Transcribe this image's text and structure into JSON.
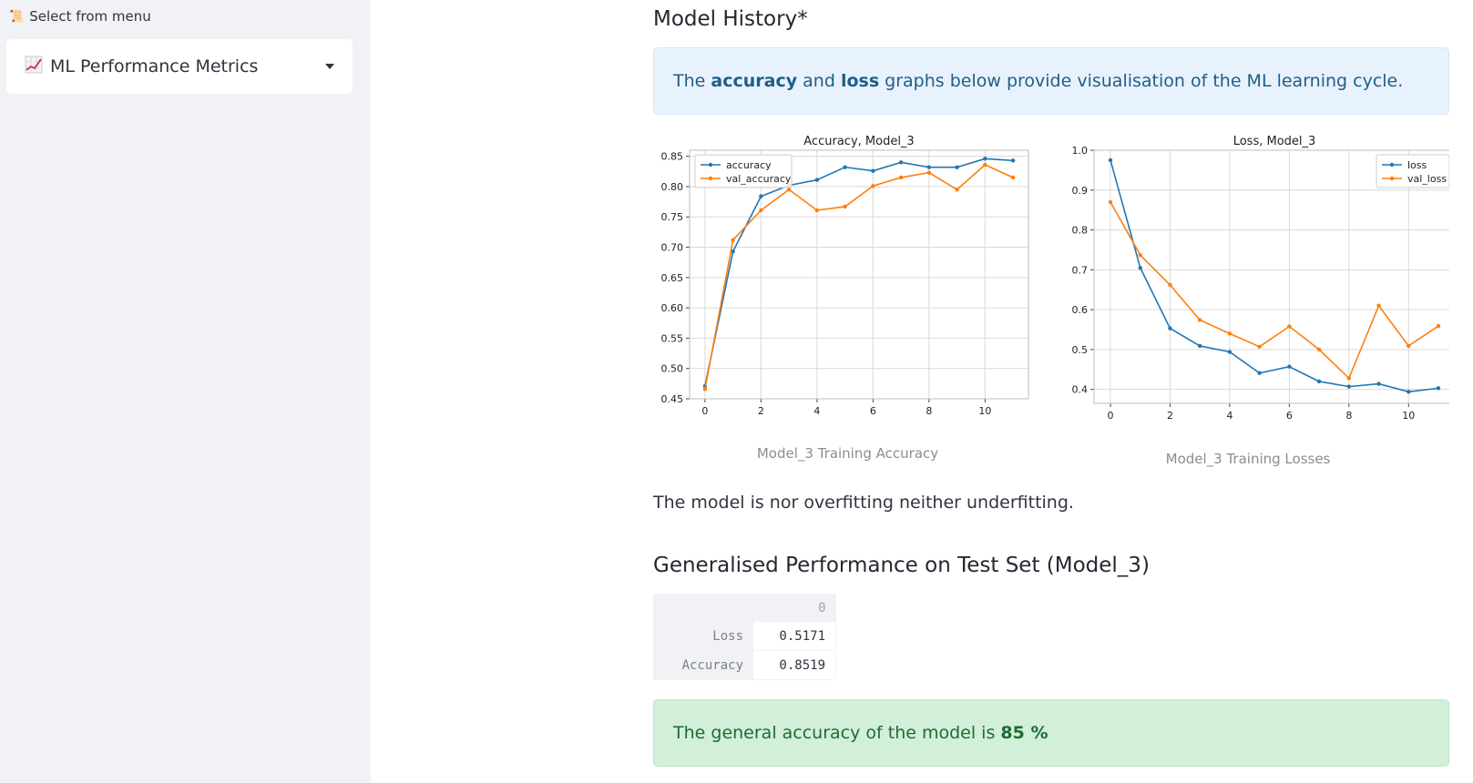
{
  "sidebar": {
    "label": "Select from menu",
    "label_icon": "scroll-icon",
    "select": {
      "value": "ML Performance Metrics",
      "icon": "chart-increasing-icon"
    }
  },
  "main": {
    "history_heading": "Model History*",
    "info": {
      "pre": "The ",
      "bold1": "accuracy",
      "mid": " and ",
      "bold2": "loss",
      "post": " graphs below provide visualisation of the ML learning cycle."
    },
    "accuracy_caption": "Model_3 Training Accuracy",
    "loss_caption": "Model_3 Training Losses",
    "fit_text": "The model is nor overfitting neither underfitting.",
    "perf_heading": "Generalised Performance on Test Set (Model_3)",
    "table": {
      "column": "0",
      "rows": [
        {
          "label": "Loss",
          "value": "0.5171"
        },
        {
          "label": "Accuracy",
          "value": "0.8519"
        }
      ]
    },
    "success": {
      "pre": "The general accuracy of the model is ",
      "bold": "85 %"
    }
  },
  "colors": {
    "series1": "#1f77b4",
    "series2": "#ff7f0e",
    "info_bg": "#e8f2fc",
    "success_bg": "#d2efd9"
  },
  "chart_data": [
    {
      "type": "line",
      "title": "Accuracy, Model_3",
      "xlabel": "",
      "ylabel": "",
      "x": [
        0,
        1,
        2,
        3,
        4,
        5,
        6,
        7,
        8,
        9,
        10,
        11
      ],
      "xlim": [
        -0.55,
        11.55
      ],
      "ylim": [
        0.45,
        0.86
      ],
      "xticks": [
        0,
        2,
        4,
        6,
        8,
        10
      ],
      "yticks": [
        0.45,
        0.5,
        0.55,
        0.6,
        0.65,
        0.7,
        0.75,
        0.8,
        0.85
      ],
      "grid": true,
      "legend": "upper left",
      "series": [
        {
          "name": "accuracy",
          "color": "#1f77b4",
          "values": [
            0.471,
            0.693,
            0.784,
            0.802,
            0.811,
            0.832,
            0.826,
            0.84,
            0.832,
            0.832,
            0.846,
            0.843
          ]
        },
        {
          "name": "val_accuracy",
          "color": "#ff7f0e",
          "values": [
            0.466,
            0.712,
            0.761,
            0.795,
            0.761,
            0.767,
            0.801,
            0.815,
            0.823,
            0.795,
            0.836,
            0.815
          ]
        }
      ]
    },
    {
      "type": "line",
      "title": "Loss, Model_3",
      "xlabel": "",
      "ylabel": "",
      "x": [
        0,
        1,
        2,
        3,
        4,
        5,
        6,
        7,
        8,
        9,
        10,
        11
      ],
      "xlim": [
        -0.55,
        11.55
      ],
      "ylim": [
        0.365,
        1.0
      ],
      "xticks": [
        0,
        2,
        4,
        6,
        8,
        10
      ],
      "yticks": [
        0.4,
        0.5,
        0.6,
        0.7,
        0.8,
        0.9,
        1.0
      ],
      "grid": true,
      "legend": "upper right",
      "series": [
        {
          "name": "loss",
          "color": "#1f77b4",
          "values": [
            0.975,
            0.705,
            0.553,
            0.509,
            0.494,
            0.441,
            0.457,
            0.42,
            0.407,
            0.414,
            0.394,
            0.403
          ]
        },
        {
          "name": "val_loss",
          "color": "#ff7f0e",
          "values": [
            0.87,
            0.737,
            0.662,
            0.574,
            0.54,
            0.507,
            0.558,
            0.5,
            0.428,
            0.61,
            0.509,
            0.559
          ]
        }
      ]
    }
  ]
}
